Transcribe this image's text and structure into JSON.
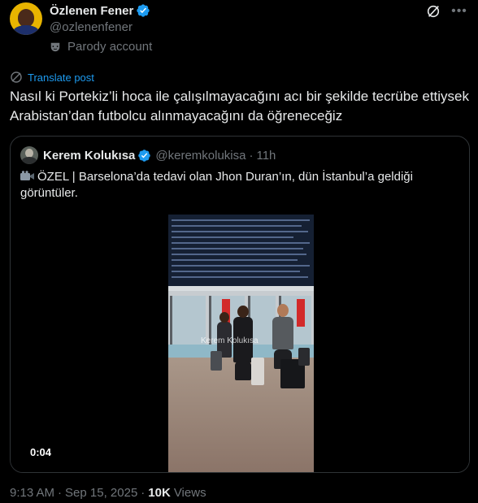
{
  "author": {
    "name": "Özlenen Fener",
    "handle": "@ozlenenfener",
    "parody_label": "Parody account",
    "verified_icon": "verified-badge-icon",
    "accent_color": "#1d9bf0"
  },
  "actions": {
    "grok_icon": "grok-icon",
    "more_icon": "more-options-icon"
  },
  "translate": {
    "label": "Translate post"
  },
  "tweet": {
    "text": "Nasıl ki Portekiz’li hoca ile çalışılmayacağını acı bir şekilde tecrübe ettiysek Arabistan’dan futbolcu alınmayacağını da öğreneceğiz"
  },
  "quoted": {
    "name": "Kerem Kolukısa",
    "handle": "@keremkolukisa",
    "time": "11h",
    "separator": "·",
    "text": "ÖZEL | Barselona’da tedavi olan Jhon Duran’ın, dün İstanbul’a geldiği görüntüler.",
    "video": {
      "watermark": "Kerem Kolukısa",
      "duration": "0:04"
    }
  },
  "footer": {
    "time": "9:13 AM",
    "date": "Sep 15, 2025",
    "separator": "·",
    "views_count": "10K",
    "views_label": "Views"
  }
}
